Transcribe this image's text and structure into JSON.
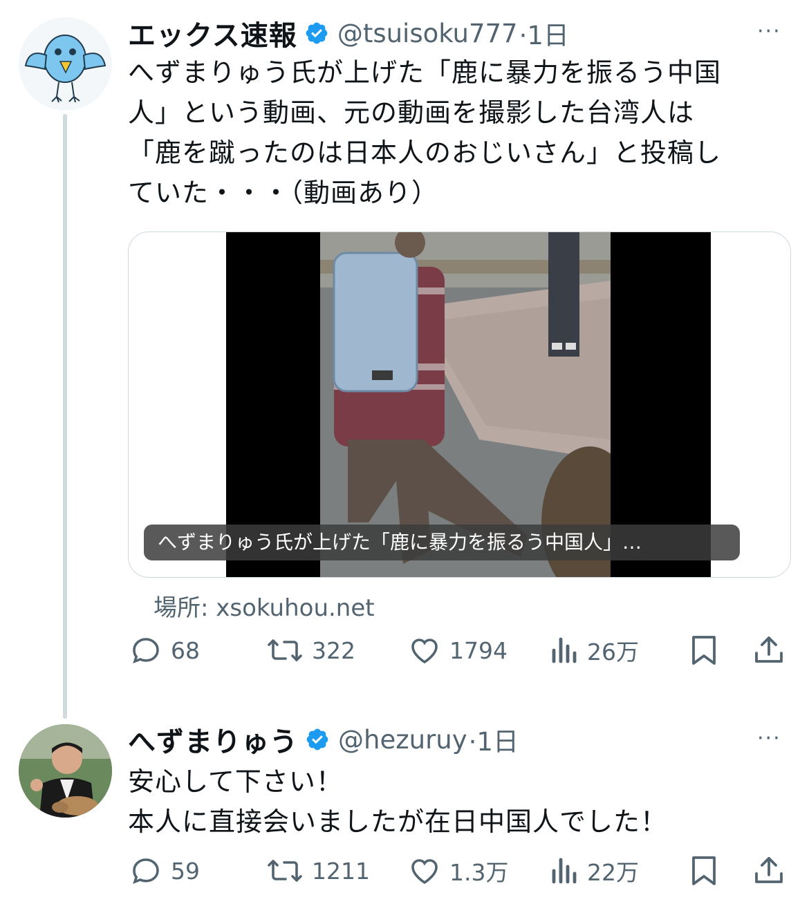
{
  "tweet1": {
    "name": "エックス速報",
    "handle": "@tsuisoku777",
    "time": "·1日",
    "more": "···",
    "text": "へずまりゅう氏が上げた「鹿に暴力を振るう中国\n人」という動画、元の動画を撮影した台湾人は\n「鹿を蹴ったのは日本人のおじいさん」と投稿し\nていた・・・（動画あり）",
    "video_caption": "へずまりゅう氏が上げた「鹿に暴力を振るう中国人」…",
    "source": "場所: xsokuhou.net",
    "stats": {
      "replies": "68",
      "retweets": "322",
      "likes": "1794",
      "views": "26万"
    }
  },
  "tweet2": {
    "name": "へずまりゅう",
    "handle": "@hezuruy",
    "time": "·1日",
    "more": "···",
    "text": "安心して下さい！\n本人に直接会いましたが在日中国人でした！",
    "stats": {
      "replies": "59",
      "retweets": "1211",
      "likes": "1.3万",
      "views": "22万"
    }
  },
  "colors": {
    "verified": "#1d9bf0",
    "muted": "#536471",
    "line": "#cfd9de"
  },
  "icons": [
    "verified-badge-icon",
    "reply-icon",
    "retweet-icon",
    "like-icon",
    "views-icon",
    "bookmark-icon",
    "share-icon",
    "more-icon"
  ]
}
